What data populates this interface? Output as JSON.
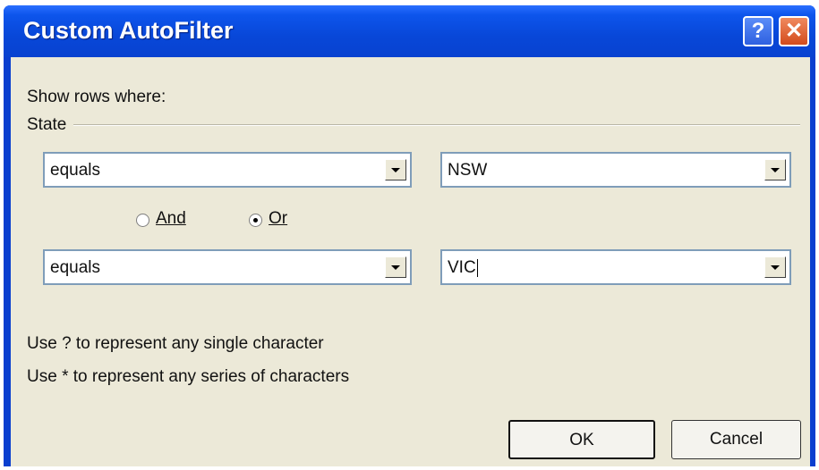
{
  "window": {
    "title": "Custom AutoFilter",
    "help_glyph": "?",
    "close_glyph": "✕"
  },
  "dialog": {
    "show_rows_label": "Show rows where:",
    "field_label": "State",
    "criteria1": {
      "operator": "equals",
      "value": "NSW"
    },
    "logic": {
      "and_label": "And",
      "or_label": "Or",
      "selected": "Or"
    },
    "criteria2": {
      "operator": "equals",
      "value": "VIC"
    },
    "hint_single": "Use ? to represent any single character",
    "hint_series": "Use * to represent any series of characters",
    "ok_label": "OK",
    "cancel_label": "Cancel"
  }
}
